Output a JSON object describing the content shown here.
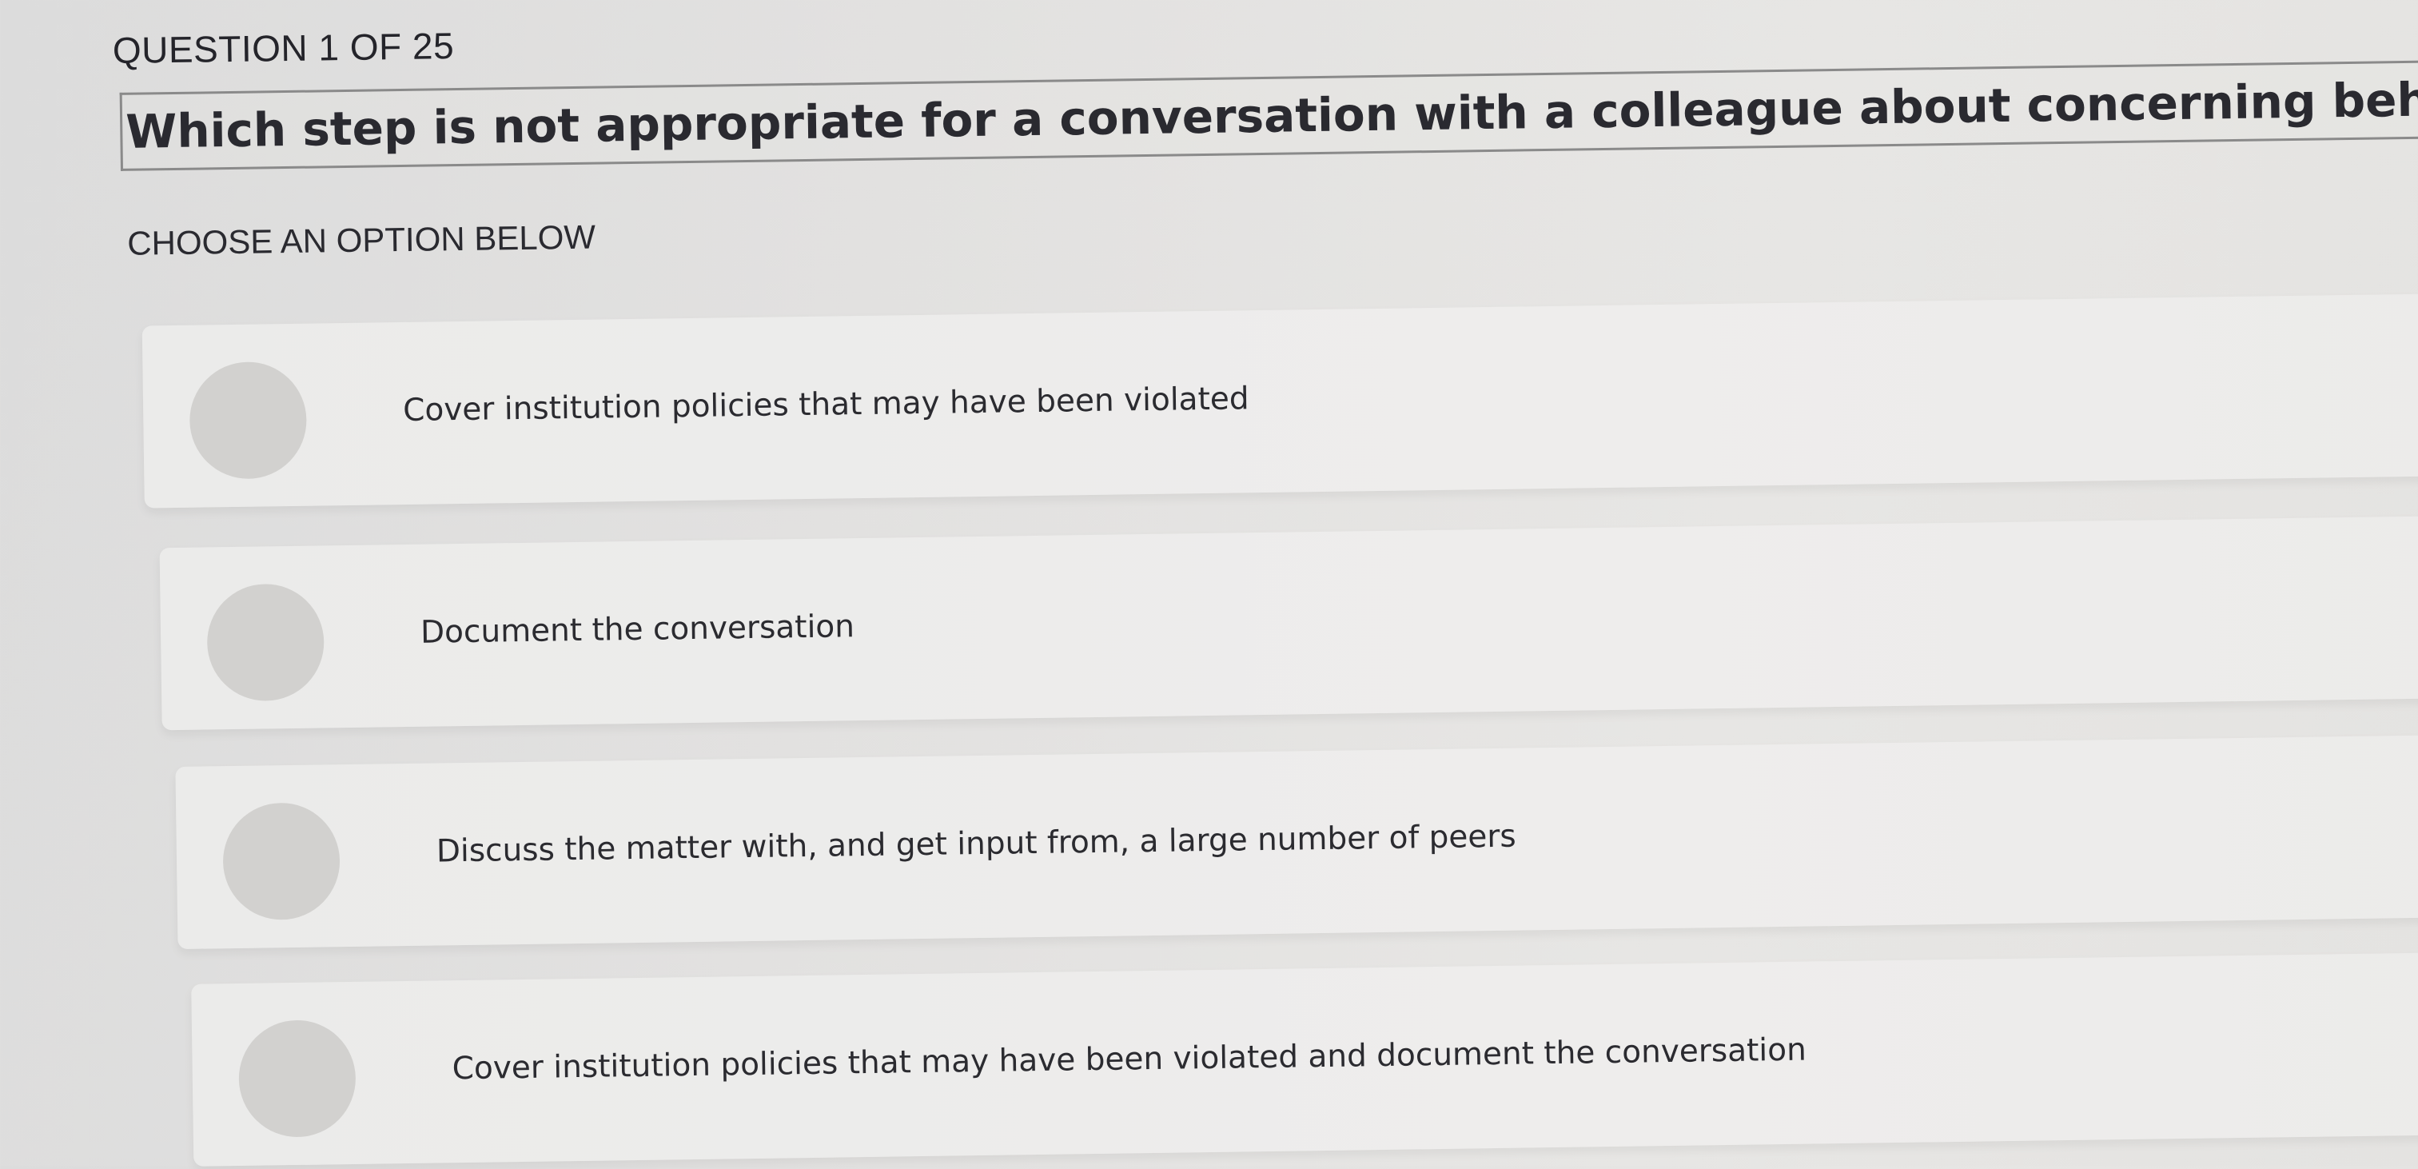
{
  "header": {
    "question_counter": "QUESTION 1 OF 25",
    "question_text": "Which step is not appropriate for a conversation with a colleague about concerning behavior?",
    "instruction": "CHOOSE AN OPTION BELOW"
  },
  "options": [
    {
      "label": "Cover institution policies that may have been violated",
      "selected": false
    },
    {
      "label": "Document the conversation",
      "selected": false
    },
    {
      "label": "Discuss the matter with, and get input from, a large number of peers",
      "selected": false
    },
    {
      "label": "Cover institution policies that may have been violated and document the conversation",
      "selected": false
    }
  ],
  "colors": {
    "background": "#e4e3e1",
    "option_background": "#edecea",
    "radio_fill": "#d2d1cf",
    "text": "#2a2a30"
  }
}
